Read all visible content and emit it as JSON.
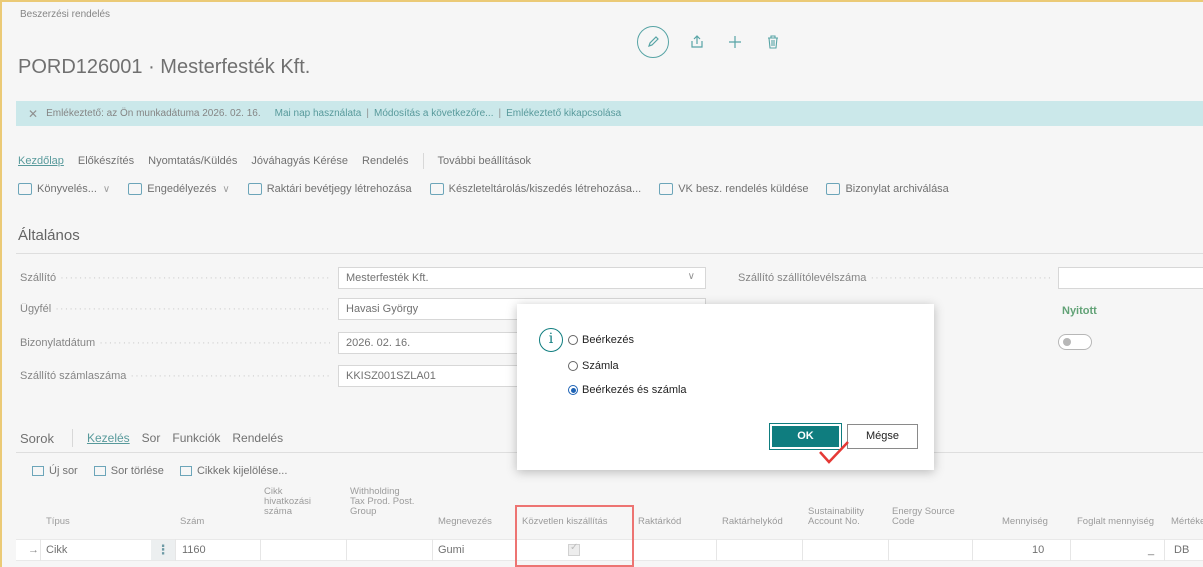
{
  "page": {
    "breadcrumb": "Beszerzési rendelés",
    "title": "PORD126001 · Mesterfesték Kft."
  },
  "notification": {
    "text": "Emlékeztető: az Ön munkadátuma 2026. 02. 16.",
    "links": [
      "Mai nap használata",
      "Módosítás a következőre...",
      "Emlékeztető kikapcsolása"
    ]
  },
  "menu": {
    "items": [
      "Kezdőlap",
      "Előkészítés",
      "Nyomtatás/Küldés",
      "Jóváhagyás Kérése",
      "Rendelés"
    ],
    "more": "További beállítások"
  },
  "actions": [
    "Könyvelés...",
    "Engedélyezés",
    "Raktári bevétjegy létrehozása",
    "Készleteltárolás/kiszedés létrehozása...",
    "VK besz. rendelés küldése",
    "Bizonylat archiválása"
  ],
  "general": {
    "title": "Általános",
    "fields": [
      {
        "label": "Szállító",
        "value": "Mesterfesték Kft."
      },
      {
        "label": "Ügyfél",
        "value": "Havasi György"
      },
      {
        "label": "Bizonylatdátum",
        "value": "2026. 02. 16."
      },
      {
        "label": "Szállító számlaszáma",
        "value": "KKISZ001SZLA01"
      }
    ],
    "right_label": "Szállító szállítólevélszáma",
    "status": "Nyitott"
  },
  "lines": {
    "title": "Sorok",
    "tabs": [
      "Kezelés",
      "Sor",
      "Funkciók",
      "Rendelés"
    ],
    "actions": [
      "Új sor",
      "Sor törlése",
      "Cikkek kijelölése..."
    ],
    "columns": {
      "type": "Típus",
      "no": "Szám",
      "item_ref_1": "Cikk",
      "item_ref_2": "hivatkozási",
      "item_ref_3": "száma",
      "wh_1": "Withholding",
      "wh_2": "Tax Prod. Post.",
      "wh_3": "Group",
      "desc": "Megnevezés",
      "drop_ship": "Közvetlen kiszállítás",
      "location": "Raktárkód",
      "bin": "Raktárhelykód",
      "sust_1": "Sustainability",
      "sust_2": "Account No.",
      "energy_1": "Energy Source",
      "energy_2": "Code",
      "qty": "Mennyiség",
      "reserved": "Foglalt mennyiség",
      "uom": "Mértéke"
    },
    "row": {
      "type": "Cikk",
      "no": "1160",
      "desc": "Gumi",
      "qty": "10",
      "reserved": "_",
      "uom": "DB"
    }
  },
  "dialog": {
    "options": [
      "Beérkezés",
      "Számla",
      "Beérkezés és számla"
    ],
    "selected_index": 2,
    "ok": "OK",
    "cancel": "Mégse"
  },
  "colors": {
    "accent": "#0f7d7f",
    "highlight": "#e53935",
    "notification": "#b5dfe1"
  }
}
